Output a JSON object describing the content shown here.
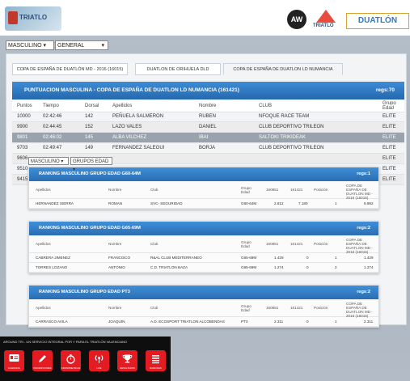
{
  "header": {
    "logo_text": "TRIATLO",
    "aw_text": "AW",
    "tri_text": "TRIATLÓ",
    "duatlon_text": "DUATLÓN"
  },
  "filters": {
    "gender": "MASCULINO ▾",
    "category": "GENERAL",
    "category_arrow": "▾"
  },
  "tabs": [
    {
      "label": "COPA DE ESPAÑA DE DUATLÓN MD - 2016 (16015)"
    },
    {
      "label": "DUATLON DE ORIHUELA DLD"
    },
    {
      "label": "COPA DE ESPAÑA DE DUATLON LD NUMANCIA"
    }
  ],
  "main": {
    "title": "PUNTUACION MASCULINA - COPA DE ESPAÑA DE DUATLON LD NUMANCIA (161421)",
    "count": "regs:70",
    "columns": [
      "Puntos",
      "Tiempo",
      "Dorsal",
      "Apellidos",
      "Nombre",
      "CLUB",
      "Grupo Edad"
    ],
    "rows": [
      [
        "10000",
        "02:42:46",
        "142",
        "PEÑUELA SALMERON",
        "RUBEN",
        "NFOQUE RACE TEAM",
        "ELITE"
      ],
      [
        "9900",
        "02:44:45",
        "152",
        "LAZO VALES",
        "DANIEL",
        "CLUB DEPORTIVO TRILEON",
        "ELITE"
      ],
      [
        "9801",
        "02:46:02",
        "145",
        "ALBA VILCHEZ",
        "IBAI",
        "SALTOKI TRIKIDEAK",
        "ELITE"
      ],
      [
        "9703",
        "02:49:47",
        "149",
        "FERNANDEZ SALEGUI",
        "BORJA",
        "CLUB DEPORTIVO TRILEON",
        "ELITE"
      ],
      [
        "9606",
        "",
        "",
        "",
        "",
        "",
        "ELITE"
      ],
      [
        "9510",
        "",
        "",
        "",
        "",
        "",
        "ELITE"
      ],
      [
        "9415",
        "",
        "",
        "",
        "",
        "",
        "ELITE"
      ]
    ]
  },
  "subfilters": {
    "gender": "MASCULINO ▾",
    "group": "GRUPOS EDAD ▾"
  },
  "cards": [
    {
      "title": "RANKING MASCULINO GRUPO EDAD G60-64M",
      "count": "regs:1",
      "headers": [
        "Apellidos",
        "Nombre",
        "Club",
        "Grupo Edad",
        "160851",
        "161421",
        "Posición",
        "COPA DE ESPAÑA DE DUATLON MD - 2016 (16015)"
      ],
      "rows": [
        [
          "HERNANDEZ SIERRA",
          "ROMAN",
          "SVC- SEGURIDAD",
          "G60-64M",
          "2.812",
          "7.180",
          "1",
          "9.992"
        ]
      ]
    },
    {
      "title": "RANKING MASCULINO GRUPO EDAD G65-69M",
      "count": "regs:2",
      "headers": [
        "Apellidos",
        "Nombre",
        "Club",
        "Grupo Edad",
        "160851",
        "161421",
        "Posición",
        "COPA DE ESPAÑA DE DUATLON MD - 2016 (16015)"
      ],
      "rows": [
        [
          "CABRERA JIMENEZ",
          "FRANCISCO",
          "R&AL CLUB MEDITERRANEO",
          "G65-69M",
          "1.429",
          "0",
          "1",
          "1.429"
        ],
        [
          "TORRES LOZANO",
          "ANTONIO",
          "C.D. TRIATLON BAZA",
          "G65-69M",
          "1.274",
          "0",
          "2",
          "1.274"
        ]
      ]
    },
    {
      "title": "RANKING MASCULINO GRUPO EDAD PT3",
      "count": "regs:2",
      "headers": [
        "Apellidos",
        "Nombre",
        "Club",
        "Grupo Edad",
        "160851",
        "161421",
        "Posición",
        "COPA DE ESPAÑA DE DUATLON MD - 2016 (16015)"
      ],
      "rows": [
        [
          "CARRASCO AVILA",
          "JOAQUIN",
          "A.D. ECOSPORT TRIATLON ALCOBENDAS",
          "PT3",
          "2.311",
          "0",
          "1",
          "2.311"
        ]
      ]
    }
  ],
  "footer": {
    "tagline": "AROUND TRI - UN SERVICIO INTEGRAL POR Y PARA EL TRIATLÓN VALENCIANO",
    "icons": [
      {
        "label": "LICENCIAS",
        "icon": "id-card-icon"
      },
      {
        "label": "INSCRIPCIONES",
        "icon": "pencil-icon"
      },
      {
        "label": "CRONOMETRAJE",
        "icon": "stopwatch-icon"
      },
      {
        "label": "LIVE",
        "icon": "broadcast-icon"
      },
      {
        "label": "RESULTADOS",
        "icon": "trophy-icon"
      },
      {
        "label": "RANKINGS",
        "icon": "list-icon"
      }
    ]
  }
}
